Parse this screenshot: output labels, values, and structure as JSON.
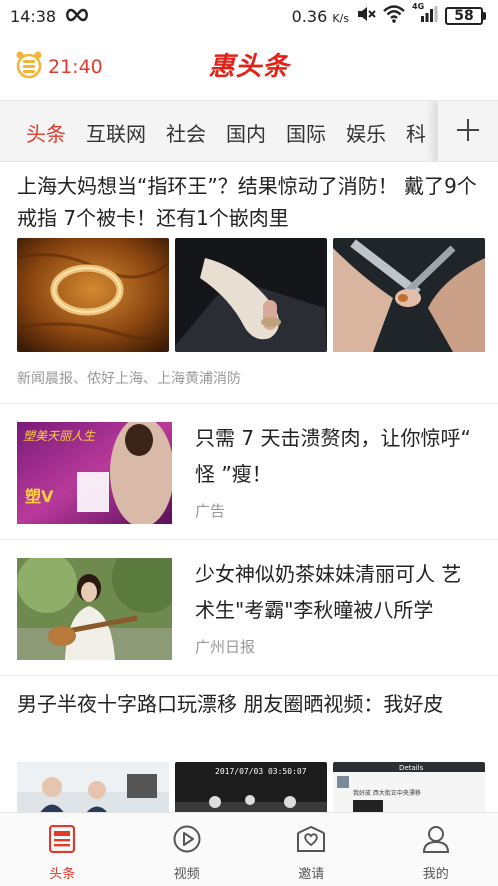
{
  "status_bar": {
    "time": "14:38",
    "net_speed": "0.36",
    "net_unit": "K/s",
    "signal_label": "4G",
    "battery": "58"
  },
  "header": {
    "timer": "21:40",
    "logo": "惠头条"
  },
  "tabs": [
    {
      "label": "头条",
      "active": true
    },
    {
      "label": "互联网"
    },
    {
      "label": "社会"
    },
    {
      "label": "国内"
    },
    {
      "label": "国际"
    },
    {
      "label": "娱乐"
    },
    {
      "label": "科"
    }
  ],
  "feed": {
    "article1": {
      "title": "上海大妈想当“指环王”？结果惊动了消防！ 戴了9个戒指 7个被卡！还有1个嵌肉里",
      "source": "新闻晨报、侬好上海、上海黄浦消防"
    },
    "ad": {
      "title": "只需 7 天击溃赘肉，让你惊呼“ 怪 ”瘦！",
      "source": "广告",
      "banner_text": "塑美天丽人生",
      "badge": "塑V"
    },
    "article3": {
      "title": "少女神似奶茶妹妹清丽可人 艺术生\"考霸\"李秋曈被八所学",
      "source": "广州日报"
    },
    "article4": {
      "title": "男子半夜十字路口玩漂移 朋友圈晒视频：我好皮",
      "thumb_timestamp": "2017/07/03 03:50:07",
      "thumb_details": "Details",
      "thumb_chat": "我好皮 西大街正中央漂移"
    }
  },
  "bottom_nav": [
    {
      "label": "头条",
      "icon": "news-icon",
      "active": true
    },
    {
      "label": "视频",
      "icon": "play-icon"
    },
    {
      "label": "邀请",
      "icon": "invite-heart-icon"
    },
    {
      "label": "我的",
      "icon": "user-icon"
    }
  ],
  "colors": {
    "accent": "#e23a2a",
    "logo": "#e2231a",
    "timer_icon": "#f2b53a"
  }
}
